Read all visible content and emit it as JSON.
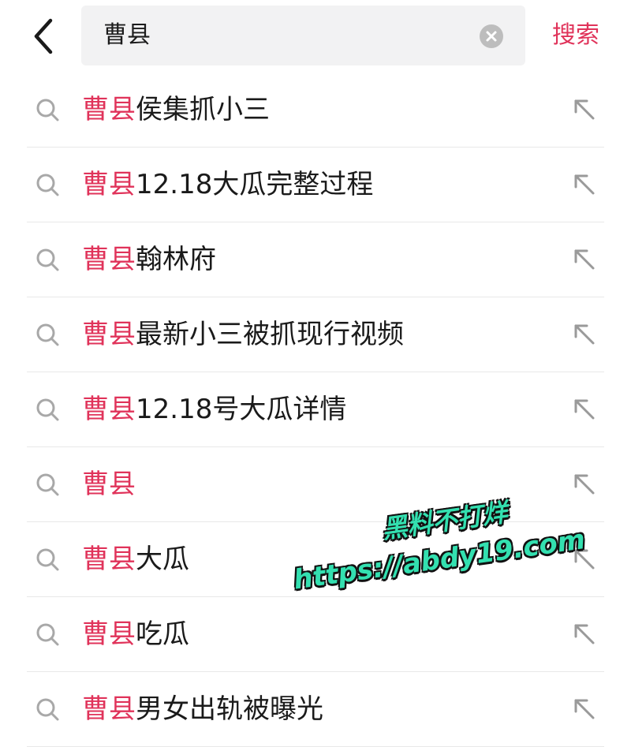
{
  "search": {
    "query": "曹县",
    "submit_label": "搜索"
  },
  "icons": {
    "back": "chevron-left-icon",
    "clear": "clear-circle-icon",
    "search": "search-icon",
    "fill": "arrow-up-left-icon"
  },
  "colors": {
    "accent": "#e0335a",
    "watermark": "#33e0b0"
  },
  "suggestions": [
    {
      "highlight": "曹县",
      "rest": "侯集抓小三"
    },
    {
      "highlight": "曹县",
      "rest": "12.18大瓜完整过程"
    },
    {
      "highlight": "曹县",
      "rest": "翰林府"
    },
    {
      "highlight": "曹县",
      "rest": "最新小三被抓现行视频"
    },
    {
      "highlight": "曹县",
      "rest": "12.18号大瓜详情"
    },
    {
      "highlight": "曹县",
      "rest": ""
    },
    {
      "highlight": "曹县",
      "rest": "大瓜"
    },
    {
      "highlight": "曹县",
      "rest": "吃瓜"
    },
    {
      "highlight": "曹县",
      "rest": "男女出轨被曝光"
    }
  ],
  "watermark": {
    "line1": "黑料不打烊",
    "line2": "https://abdy19.com"
  }
}
